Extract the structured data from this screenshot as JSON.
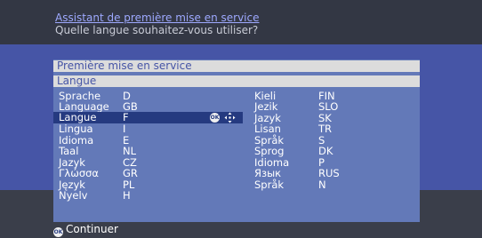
{
  "header": {
    "title": "Assistant de première mise en service",
    "question": "Quelle langue souhaitez-vous utiliser?"
  },
  "panel": {
    "title": "Première mise en service",
    "section": "Langue"
  },
  "ok_icon_text": "OK",
  "languages_left": [
    {
      "name": "Sprache",
      "code": "D"
    },
    {
      "name": "Language",
      "code": "GB"
    },
    {
      "name": "Langue",
      "code": "F"
    },
    {
      "name": "Lingua",
      "code": "I"
    },
    {
      "name": "Idioma",
      "code": "E"
    },
    {
      "name": "Taal",
      "code": "NL"
    },
    {
      "name": "Jazyk",
      "code": "CZ"
    },
    {
      "name": "Γλώσσα",
      "code": "GR"
    },
    {
      "name": "Język",
      "code": "PL"
    },
    {
      "name": "Nyelv",
      "code": "H"
    }
  ],
  "languages_right": [
    {
      "name": "Kieli",
      "code": "FIN"
    },
    {
      "name": "Jezik",
      "code": "SLO"
    },
    {
      "name": "Jazyk",
      "code": "SK"
    },
    {
      "name": "Lisan",
      "code": "TR"
    },
    {
      "name": "Språk",
      "code": "S"
    },
    {
      "name": "Sprog",
      "code": "DK"
    },
    {
      "name": "Idioma",
      "code": "P"
    },
    {
      "name": "Язык",
      "code": "RUS"
    },
    {
      "name": "Språk",
      "code": "N"
    }
  ],
  "selected_index": 2,
  "footer": {
    "continue_label": "Continuer"
  },
  "colors": {
    "highlight": "#253a80",
    "panel": "#6379b8",
    "band": "#4655a6",
    "link": "#9ea9ff"
  },
  "icons": [
    "ok-icon",
    "navigation-arrows-icon"
  ]
}
